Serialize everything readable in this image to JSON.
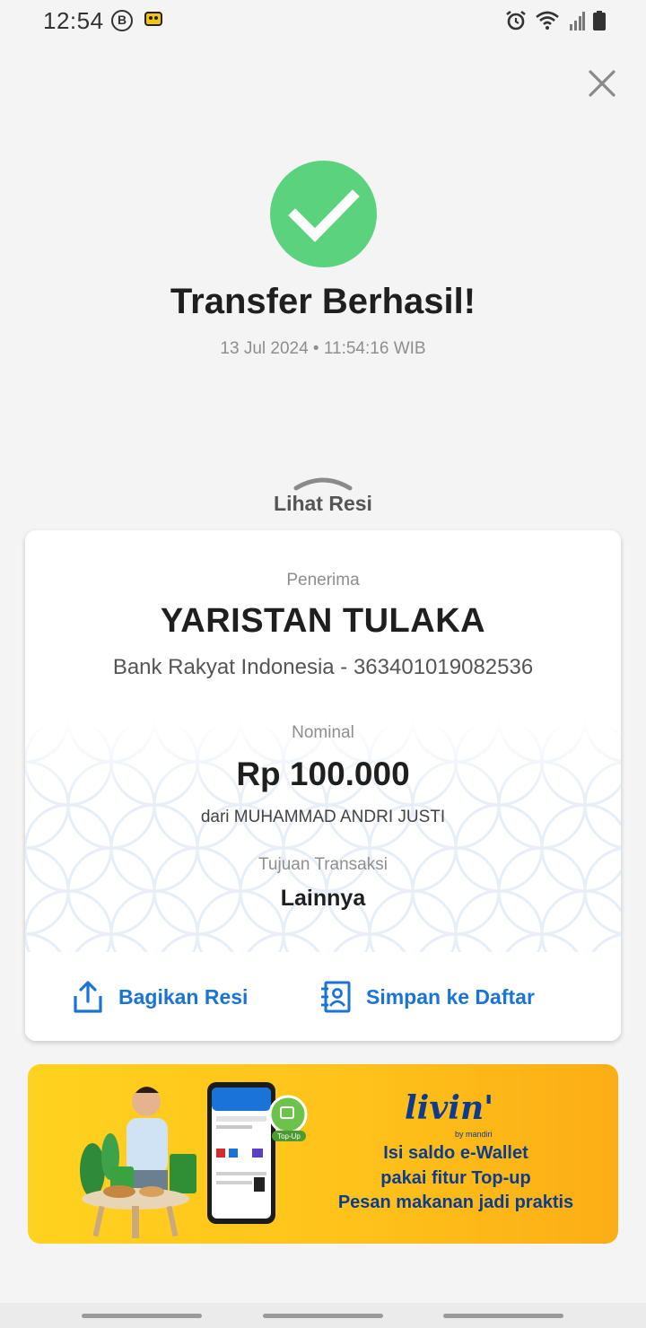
{
  "status_bar": {
    "time": "12:54",
    "left_icons": [
      "b-circle-icon",
      "app-notification-icon"
    ],
    "right_icons": [
      "alarm-icon",
      "wifi-icon",
      "signal-icon",
      "battery-icon"
    ]
  },
  "header": {
    "close_icon": "close-icon"
  },
  "result": {
    "icon": "check-icon",
    "title": "Transfer Berhasil!",
    "datetime": "13 Jul 2024 • 11:54:16 WIB"
  },
  "receipt_toggle": {
    "label": "Lihat Resi",
    "icon": "chevron-up-icon"
  },
  "receipt": {
    "recipient_label": "Penerima",
    "recipient_name": "YARISTAN TULAKA",
    "recipient_bank": "Bank Rakyat Indonesia - 363401019082536",
    "amount_label": "Nominal",
    "amount": "Rp 100.000",
    "sender": "dari MUHAMMAD ANDRI JUSTI",
    "purpose_label": "Tujuan Transaksi",
    "purpose": "Lainnya"
  },
  "actions": {
    "share_label": "Bagikan Resi",
    "share_icon": "share-icon",
    "save_label": "Simpan ke Daftar",
    "save_icon": "contact-add-icon",
    "color": "#1a73d9"
  },
  "promo": {
    "logo": "livin'",
    "logo_sub": "by mandiri",
    "line1": "Isi saldo e-Wallet",
    "line2": "pakai fitur Top-up",
    "line3": "Pesan makanan jadi praktis",
    "phone_badge": "Top-Up"
  },
  "colors": {
    "success": "#5bd27e",
    "accent": "#1a73d9",
    "promo_bg": "#ffc21a",
    "promo_text": "#0d3c8c"
  }
}
